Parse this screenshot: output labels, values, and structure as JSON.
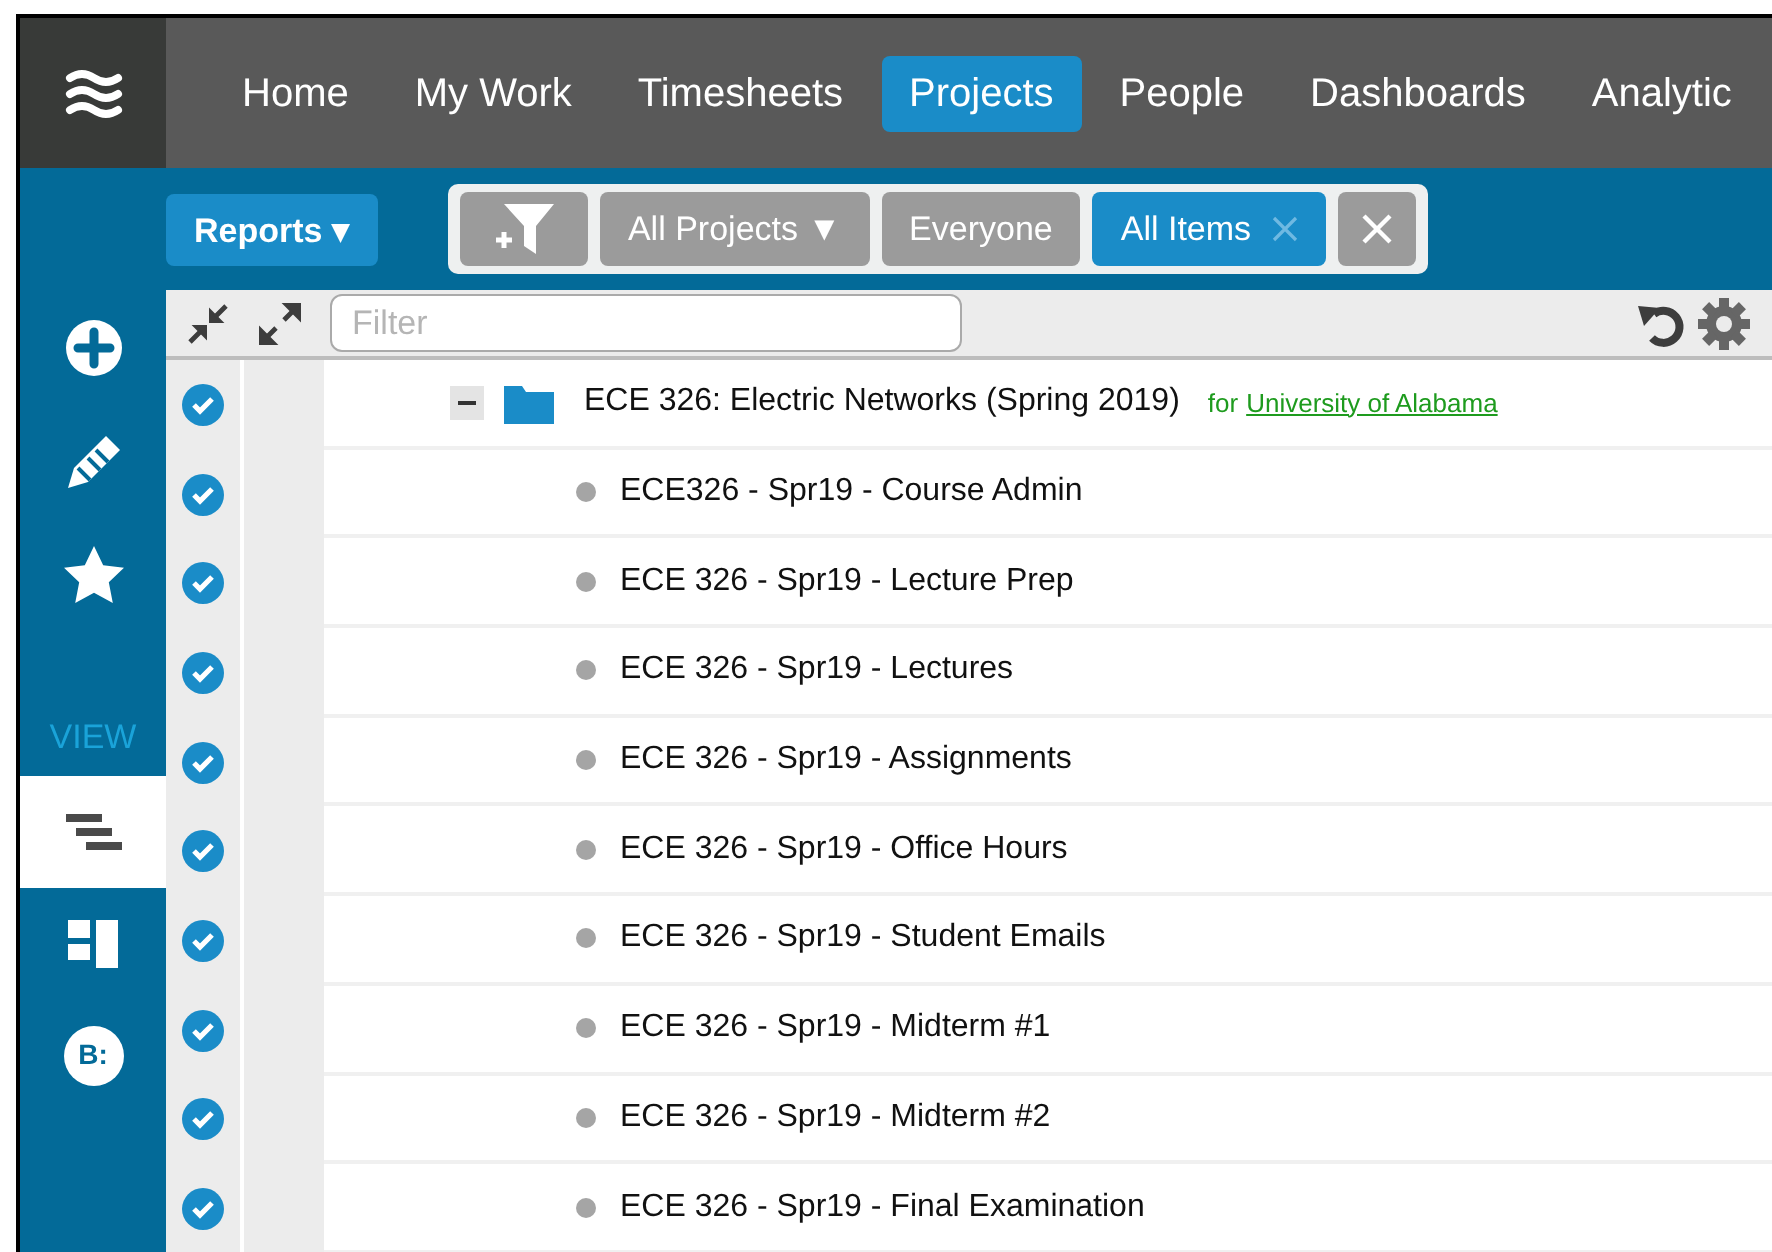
{
  "nav": {
    "items": [
      {
        "label": "Home",
        "selected": false
      },
      {
        "label": "My Work",
        "selected": false
      },
      {
        "label": "Timesheets",
        "selected": false
      },
      {
        "label": "Projects",
        "selected": true
      },
      {
        "label": "People",
        "selected": false
      },
      {
        "label": "Dashboards",
        "selected": false
      },
      {
        "label": "Analytic",
        "selected": false
      }
    ]
  },
  "toolbar": {
    "reports_button": "Reports ▾",
    "filters": [
      {
        "kind": "add-filter"
      },
      {
        "kind": "chip",
        "label": "All Projects ▼",
        "selected": false,
        "removable": false
      },
      {
        "kind": "chip",
        "label": "Everyone",
        "selected": false,
        "removable": false
      },
      {
        "kind": "chip",
        "label": "All Items",
        "selected": true,
        "removable": true
      },
      {
        "kind": "clear"
      }
    ]
  },
  "sidebar": {
    "actions": [
      {
        "kind": "add"
      },
      {
        "kind": "edit"
      },
      {
        "kind": "favorite"
      }
    ],
    "view_label": "VIEW",
    "views": [
      {
        "kind": "gantt",
        "selected": true
      },
      {
        "kind": "board",
        "selected": false
      },
      {
        "kind": "badge",
        "label": "B:",
        "selected": false
      }
    ]
  },
  "filter_bar": {
    "placeholder": "Filter"
  },
  "tree": {
    "rows": [
      {
        "label": "ECE 326: Electric Networks (Spring 2019)",
        "checked": true,
        "expanded": true,
        "client_prefix": "for",
        "client": "University of Alabama",
        "children": [
          {
            "label": "ECE326 - Spr19 - Course Admin",
            "checked": true
          },
          {
            "label": "ECE 326 - Spr19 - Lecture Prep",
            "checked": true
          },
          {
            "label": "ECE 326 - Spr19 - Lectures",
            "checked": true
          },
          {
            "label": "ECE 326 - Spr19 - Assignments",
            "checked": true
          },
          {
            "label": "ECE 326 - Spr19 - Office Hours",
            "checked": true
          },
          {
            "label": "ECE 326 - Spr19 - Student Emails",
            "checked": true
          },
          {
            "label": "ECE 326 - Spr19 - Midterm #1",
            "checked": true
          },
          {
            "label": "ECE 326 - Spr19 - Midterm #2",
            "checked": true
          },
          {
            "label": "ECE 326 - Spr19 - Final Examination",
            "checked": true
          }
        ]
      }
    ]
  }
}
